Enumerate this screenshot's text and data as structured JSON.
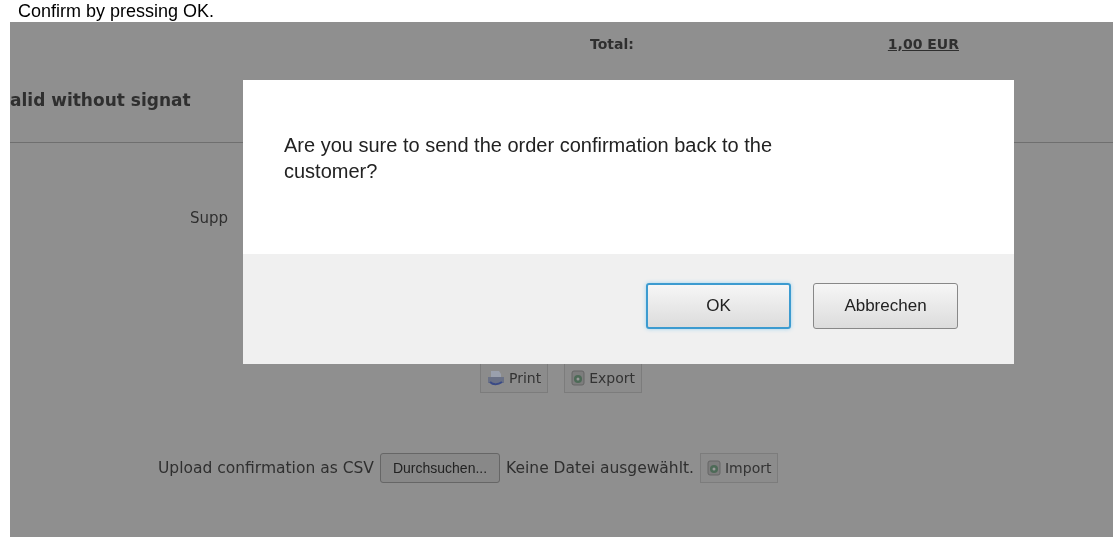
{
  "caption": "Confirm by pressing OK.",
  "page": {
    "total_label": "Total:",
    "total_value": "1,00 EUR",
    "note": "alid without signat",
    "support_label": "Supp",
    "actions": [
      {
        "label": "Print",
        "kind": "print"
      },
      {
        "label": "Export",
        "kind": "export"
      }
    ],
    "upload": {
      "label": "Upload confirmation as CSV",
      "browse_button": "Durchsuchen...",
      "file_status": "Keine Datei ausgewählt.",
      "import_button": "Import"
    }
  },
  "dialog": {
    "message": "Are you sure to send the order confirmation back to the customer?",
    "buttons": [
      {
        "label": "OK",
        "focused": true
      },
      {
        "label": "Abbrechen",
        "focused": false
      }
    ]
  }
}
